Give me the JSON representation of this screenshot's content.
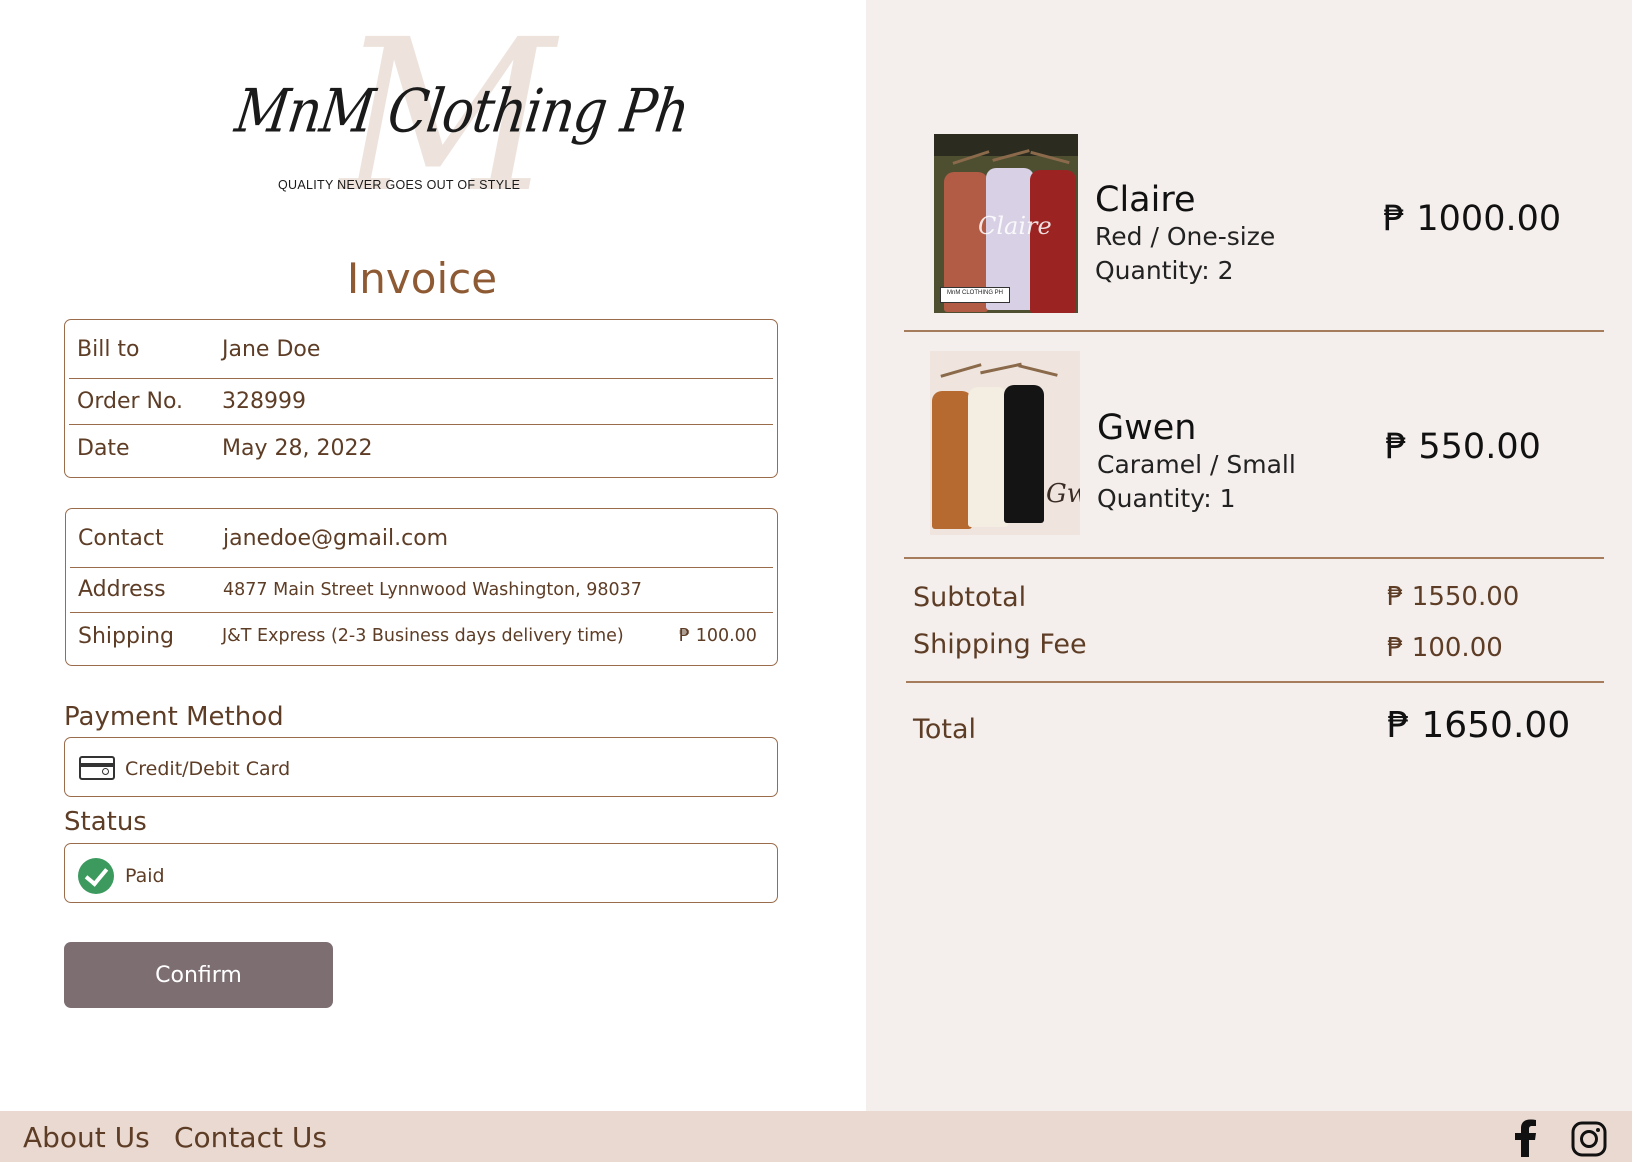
{
  "brand": {
    "logo_text": "MnM Clothing Ph",
    "tagline": "QUALITY NEVER GOES OUT OF STYLE"
  },
  "invoice": {
    "title": "Invoice",
    "billing": [
      {
        "label": "Bill to",
        "value": "Jane Doe"
      },
      {
        "label": "Order No.",
        "value": "328999"
      },
      {
        "label": "Date",
        "value": "May 28, 2022"
      }
    ],
    "contact": [
      {
        "label": "Contact",
        "value": "janedoe@gmail.com"
      },
      {
        "label": "Address",
        "value": "4877 Main Street Lynnwood Washington, 98037"
      },
      {
        "label": "Shipping",
        "value": "J&T Express (2-3 Business days delivery time)",
        "price": "₱ 100.00"
      }
    ],
    "payment_method_label": "Payment Method",
    "payment_method": "Credit/Debit Card",
    "payment_icon": "credit-card-icon",
    "status_label": "Status",
    "status": "Paid",
    "status_icon": "check-circle-icon",
    "status_color": "#3c9a5e",
    "confirm_label": "Confirm",
    "confirm_color": "#7d6e72"
  },
  "cart": {
    "items": [
      {
        "name": "Claire",
        "variant": "Red / One-size",
        "quantity": "Quantity: 2",
        "price": "₱ 1000.00",
        "image_watermark": "Claire",
        "image_tag": "MnM CLOTHING PH"
      },
      {
        "name": "Gwen",
        "variant": "Caramel / Small",
        "quantity": "Quantity: 1",
        "price": "₱ 550.00",
        "image_watermark": "Gw"
      }
    ],
    "subtotal_label": "Subtotal",
    "subtotal": "₱ 1550.00",
    "shipping_fee_label": "Shipping Fee",
    "shipping_fee": "₱ 100.00",
    "total_label": "Total",
    "total": "₱ 1650.00"
  },
  "footer": {
    "about": "About Us",
    "contact": "Contact Us",
    "social_icons": [
      "facebook-icon",
      "instagram-icon"
    ],
    "background": "#ead9d1"
  },
  "colors": {
    "accent_brown": "#8e5a34",
    "border_brown": "#9a6c4b",
    "panel_bg": "#f4efec"
  }
}
